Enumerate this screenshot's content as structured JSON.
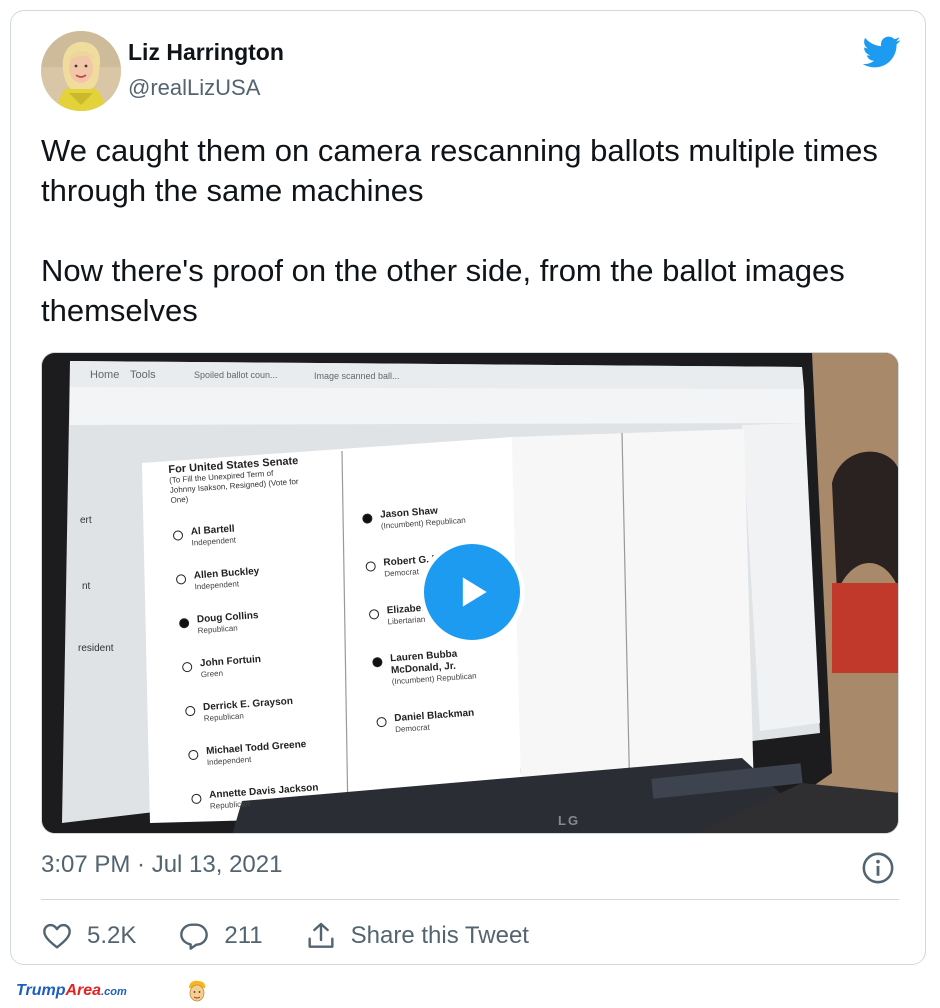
{
  "author": {
    "name": "Liz Harrington",
    "handle": "@realLizUSA"
  },
  "tweet": {
    "paragraphs": [
      "We caught them on camera rescanning ballots multiple times through the same machines",
      "Now there's proof on the other side, from the ballot images themselves"
    ],
    "timestamp": "3:07 PM · Jul 13, 2021"
  },
  "media": {
    "type": "video",
    "browser_tabs": [
      "Home",
      "Tools",
      "Spoiled ballot coun...",
      "Image scanned ball..."
    ],
    "ballot_left": {
      "heading": "For United States Senate",
      "subheading": "(To Fill the Unexpired Term of Johnny Isakson, Resigned) (Vote for One)",
      "candidates": [
        {
          "name": "Al Bartell",
          "party": "Independent",
          "filled": false
        },
        {
          "name": "Allen Buckley",
          "party": "Independent",
          "filled": false
        },
        {
          "name": "Doug Collins",
          "party": "Republican",
          "filled": true
        },
        {
          "name": "John Fortuin",
          "party": "Green",
          "filled": false
        },
        {
          "name": "Derrick E. Grayson",
          "party": "Republican",
          "filled": false
        },
        {
          "name": "Michael Todd Greene",
          "party": "Independent",
          "filled": false
        },
        {
          "name": "Annette Davis Jackson",
          "party": "Republican",
          "filled": false
        }
      ]
    },
    "ballot_right": {
      "candidates": [
        {
          "name": "Jason Shaw",
          "party": "(Incumbent) Republican",
          "filled": true
        },
        {
          "name": "Robert G. Bryant",
          "party": "Democrat",
          "filled": false
        },
        {
          "name": "Elizabeth Melton",
          "party": "Libertarian",
          "filled": false
        },
        {
          "name": "Lauren Bubba McDonald, Jr.",
          "party": "(Incumbent) Republican",
          "filled": true
        },
        {
          "name": "Daniel Blackman",
          "party": "Democrat",
          "filled": false
        }
      ]
    },
    "left_margin_labels": [
      "ert",
      "nt",
      "resident"
    ],
    "laptop_brand": "LG"
  },
  "actions": {
    "likes": "5.2K",
    "replies": "211",
    "share_label": "Share this Tweet"
  },
  "watermark": {
    "part1": "Trump",
    "part2": "Area",
    "part3": ".com"
  },
  "colors": {
    "brand_blue": "#1d9bf0",
    "text_primary": "#0f1419",
    "text_secondary": "#536471",
    "border": "#cfd9de"
  },
  "icons": [
    "twitter-bird-icon",
    "play-icon",
    "info-icon",
    "heart-icon",
    "reply-icon",
    "share-icon"
  ]
}
